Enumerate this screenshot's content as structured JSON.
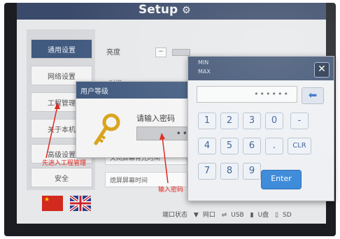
{
  "header": {
    "title": "Setup",
    "icon": "gear-icon"
  },
  "sidebar": {
    "items": [
      {
        "label": "通用设置",
        "active": true
      },
      {
        "label": "网络设置",
        "active": false
      },
      {
        "label": "工程管理",
        "active": false
      },
      {
        "label": "关于本机",
        "active": false
      },
      {
        "label": "高级设置",
        "active": false
      },
      {
        "label": "安全",
        "active": false
      }
    ]
  },
  "content": {
    "brightness_label": "亮度",
    "time_label": "时间",
    "row_backlight": "关闭屏幕背光时间",
    "row_screensaver": "熄屏屏幕时间"
  },
  "level_dialog": {
    "title": "用户等级",
    "prompt": "请输入密码",
    "password_value": "••••"
  },
  "keypad": {
    "min_label": "MIN",
    "max_label": "MAX",
    "display_value": "••••••",
    "keys": [
      "1",
      "2",
      "3",
      "0",
      "-",
      "4",
      "5",
      "6",
      ".",
      "CLR",
      "7",
      "8",
      "9"
    ],
    "enter_label": "Enter",
    "close_label": "✕"
  },
  "annotations": {
    "left_note": "先进入工程管理",
    "bottom_note": "输入密码"
  },
  "status_bar": {
    "label": "端口状态",
    "items": [
      "网口",
      "USB",
      "U盘",
      "SD"
    ]
  },
  "colors": {
    "title_bar": "#40597e",
    "enter_button": "#3c8ad9",
    "annotation": "#e1261c"
  }
}
